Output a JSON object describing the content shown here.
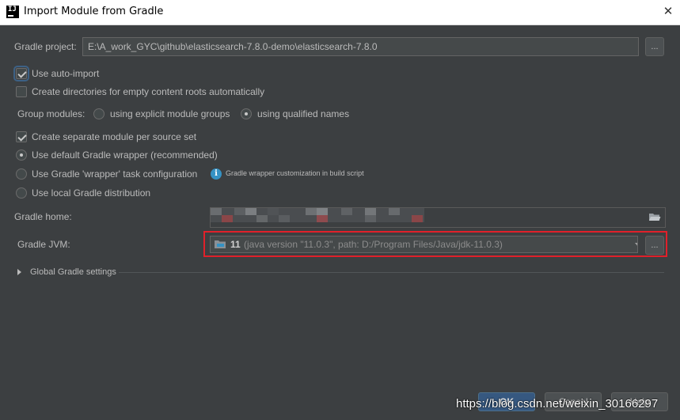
{
  "window": {
    "title": "Import Module from Gradle",
    "logo_text": "IJ",
    "close_glyph": "✕"
  },
  "form": {
    "gradle_project_label": "Gradle project:",
    "gradle_project_value": "E:\\A_work_GYC\\github\\elasticsearch-7.8.0-demo\\elasticsearch-7.8.0",
    "browse_label": "...",
    "use_auto_import": {
      "label": "Use auto-import",
      "checked": true
    },
    "create_dirs": {
      "label": "Create directories for empty content roots automatically",
      "checked": false
    },
    "group_modules_label": "Group modules:",
    "group_explicit": {
      "label": "using explicit module groups",
      "checked": false
    },
    "group_qualified": {
      "label": "using qualified names",
      "checked": true
    },
    "separate_module": {
      "label": "Create separate module per source set",
      "checked": true
    },
    "default_wrapper": {
      "label": "Use default Gradle wrapper (recommended)",
      "checked": true
    },
    "wrapper_task": {
      "label": "Use Gradle 'wrapper' task configuration",
      "checked": false
    },
    "wrapper_hint": "Gradle wrapper customization in build script",
    "local_distribution": {
      "label": "Use local Gradle distribution",
      "checked": false
    },
    "gradle_home_label": "Gradle home:",
    "gradle_jvm_label": "Gradle JVM:",
    "jvm_version": "11",
    "jvm_detail": "(java version \"11.0.3\", path: D:/Program Files/Java/jdk-11.0.3)",
    "global_settings_label": "Global Gradle settings"
  },
  "footer": {
    "ok_label": "OK",
    "cancel_label": "Cancel",
    "help_label": "Help"
  },
  "watermark": "https://blog.csdn.net/weixin_30166297",
  "colors": {
    "background": "#3c3f41",
    "highlight": "#e0202a",
    "accent": "#365880"
  },
  "icons": {
    "info": "info-icon",
    "folder": "folder-icon",
    "browse_folder": "open-folder-icon",
    "expand": "chevron-right-icon"
  }
}
